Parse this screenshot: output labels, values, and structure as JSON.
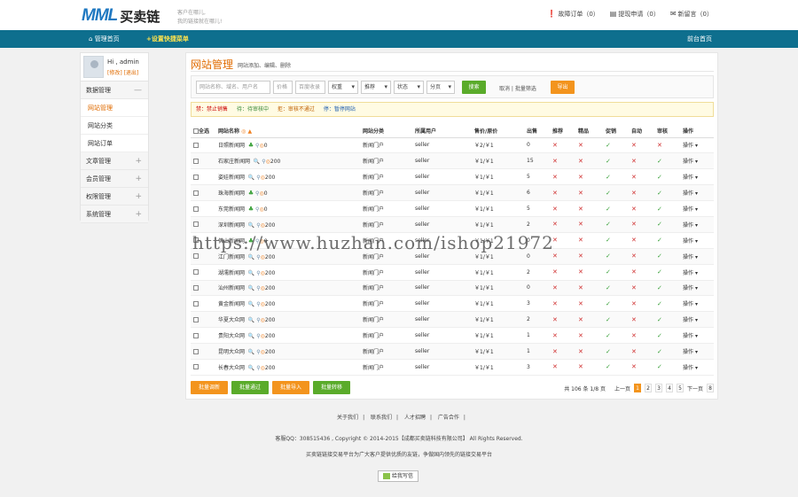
{
  "header": {
    "logo_mark": "MML",
    "logo_text": "买卖链",
    "slogan_line1": "客户在哪儿,",
    "slogan_line2": "我的链接就在哪儿!",
    "links": [
      {
        "icon": "alert-icon",
        "label": "故障订单（0）"
      },
      {
        "icon": "cash-icon",
        "label": "提现申请（0）"
      },
      {
        "icon": "message-icon",
        "label": "新留言（0）"
      }
    ]
  },
  "nav": {
    "home": "管理首页",
    "quick": "+设置快捷菜单",
    "back": "前台首页"
  },
  "sidebar": {
    "greeting": "Hi , admin",
    "user_links": "[修改] [退出]",
    "groups": [
      {
        "label": "数据管理",
        "toggle": "—",
        "items": [
          "网站管理",
          "网站分类",
          "网站订单"
        ]
      },
      {
        "label": "文章管理",
        "toggle": "+"
      },
      {
        "label": "会员管理",
        "toggle": "+"
      },
      {
        "label": "权限管理",
        "toggle": "+"
      },
      {
        "label": "系统管理",
        "toggle": "+"
      }
    ]
  },
  "main": {
    "title": "网站管理",
    "desc": "网站添加、编辑、删除",
    "filter": {
      "search_placeholder": "网站名称、域名、用户名",
      "price_placeholder": "价格",
      "baidu_placeholder": "百度收录",
      "selects": [
        "权重",
        "推荐",
        "状态",
        "分页"
      ],
      "search_btn": "搜索",
      "cancel_link": "取消 | 批量筛选",
      "export_btn": "导出"
    },
    "legend": [
      "禁：禁止销售",
      "待：待审核中",
      "拒：审核不通过",
      "停：暂停网站"
    ],
    "table": {
      "headers": [
        "全选",
        "网站名称",
        "网站分类",
        "所属用户",
        "售价/原价",
        "出售",
        "推荐",
        "精品",
        "促销",
        "自动",
        "审核",
        "操作"
      ],
      "rows": [
        {
          "name": "日照新闻网",
          "weight": "0",
          "cat": "新闻门户",
          "user": "seller",
          "price": "￥2/￥1",
          "sold": "0",
          "f": [
            "x",
            "x",
            "ok",
            "x",
            "x"
          ]
        },
        {
          "name": "石家庄新闻网",
          "weight": "200",
          "cat": "新闻门户",
          "user": "seller",
          "price": "￥1/￥1",
          "sold": "15",
          "f": [
            "x",
            "x",
            "ok",
            "x",
            "ok"
          ]
        },
        {
          "name": "姿娃新闻网",
          "weight": "200",
          "cat": "新闻门户",
          "user": "seller",
          "price": "￥1/￥1",
          "sold": "5",
          "f": [
            "x",
            "x",
            "ok",
            "x",
            "ok"
          ]
        },
        {
          "name": "珠海新闻网",
          "weight": "0",
          "cat": "新闻门户",
          "user": "seller",
          "price": "￥1/￥1",
          "sold": "6",
          "f": [
            "x",
            "x",
            "ok",
            "x",
            "ok"
          ]
        },
        {
          "name": "东莞新闻网",
          "weight": "0",
          "cat": "新闻门户",
          "user": "seller",
          "price": "￥1/￥1",
          "sold": "5",
          "f": [
            "x",
            "x",
            "ok",
            "x",
            "ok"
          ]
        },
        {
          "name": "深圳新闻网",
          "weight": "200",
          "cat": "新闻门户",
          "user": "seller",
          "price": "￥1/￥1",
          "sold": "2",
          "f": [
            "x",
            "x",
            "ok",
            "x",
            "ok"
          ]
        },
        {
          "name": "佛山新闻网",
          "weight": "0",
          "cat": "新闻门户",
          "user": "seller",
          "price": "￥1/￥1",
          "sold": "0",
          "f": [
            "x",
            "x",
            "ok",
            "x",
            "ok"
          ]
        },
        {
          "name": "江门新闻网",
          "weight": "200",
          "cat": "新闻门户",
          "user": "seller",
          "price": "￥1/￥1",
          "sold": "0",
          "f": [
            "x",
            "x",
            "ok",
            "x",
            "ok"
          ]
        },
        {
          "name": "湖濡新闻网",
          "weight": "200",
          "cat": "新闻门户",
          "user": "seller",
          "price": "￥1/￥1",
          "sold": "2",
          "f": [
            "x",
            "x",
            "ok",
            "x",
            "ok"
          ]
        },
        {
          "name": "汕州新闻网",
          "weight": "200",
          "cat": "新闻门户",
          "user": "seller",
          "price": "￥1/￥1",
          "sold": "0",
          "f": [
            "x",
            "x",
            "ok",
            "x",
            "ok"
          ]
        },
        {
          "name": "黄金新闻网",
          "weight": "200",
          "cat": "新闻门户",
          "user": "seller",
          "price": "￥1/￥1",
          "sold": "3",
          "f": [
            "x",
            "x",
            "ok",
            "x",
            "ok"
          ]
        },
        {
          "name": "华夏大众网",
          "weight": "200",
          "cat": "新闻门户",
          "user": "seller",
          "price": "￥1/￥1",
          "sold": "2",
          "f": [
            "x",
            "x",
            "ok",
            "x",
            "ok"
          ]
        },
        {
          "name": "贵阳大众网",
          "weight": "200",
          "cat": "新闻门户",
          "user": "seller",
          "price": "￥1/￥1",
          "sold": "1",
          "f": [
            "x",
            "x",
            "ok",
            "x",
            "ok"
          ]
        },
        {
          "name": "昆明大众网",
          "weight": "200",
          "cat": "新闻门户",
          "user": "seller",
          "price": "￥1/￥1",
          "sold": "1",
          "f": [
            "x",
            "x",
            "ok",
            "x",
            "ok"
          ]
        },
        {
          "name": "长春大众网",
          "weight": "200",
          "cat": "新闻门户",
          "user": "seller",
          "price": "￥1/￥1",
          "sold": "3",
          "f": [
            "x",
            "x",
            "ok",
            "x",
            "ok"
          ]
        }
      ],
      "op_label": "操作"
    },
    "bulk": [
      "批量调新",
      "批量通过",
      "批量导入",
      "批量转移"
    ],
    "pager": {
      "summary": "共 106 条 1/8 页",
      "prev": "上一页",
      "pages": [
        "1",
        "2",
        "3",
        "4",
        "5"
      ],
      "next": "下一页",
      "last": "8"
    }
  },
  "watermark": "https://www.huzhan.com/ishop21972",
  "footer": {
    "links": [
      "关于我们",
      "联系我们",
      "人才招聘",
      "广告合作"
    ],
    "copyright": "客服QQ：308515436 , Copyright © 2014-2015【成都买卖链科技有限公司】 All Rights Reserved.",
    "tagline": "买卖链链接交易平台为广大客户提供优质的友链，争做国内领先的链接交易平台",
    "seek_btn": "给我写信"
  }
}
